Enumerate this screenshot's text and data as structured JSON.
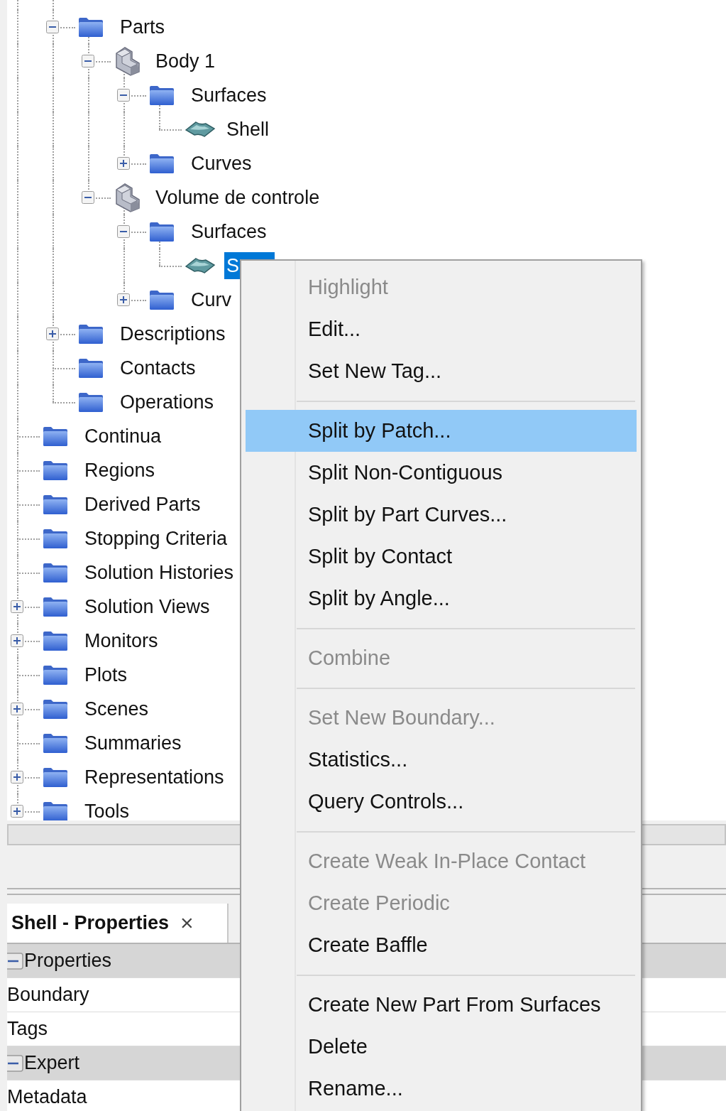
{
  "tree": {
    "items": [
      {
        "children": [
          {
            "label": "Parts",
            "kind": "folder",
            "expanded": true,
            "selected": false,
            "children": [
              {
                "label": "Body 1",
                "kind": "body",
                "expanded": true,
                "selected": false,
                "children": [
                  {
                    "label": "Surfaces",
                    "kind": "folder",
                    "expanded": true,
                    "selected": false,
                    "children": [
                      {
                        "label": "Shell",
                        "kind": "surface",
                        "selected": false
                      }
                    ]
                  },
                  {
                    "label": "Curves",
                    "kind": "folder",
                    "expanded": false,
                    "selected": false
                  }
                ]
              },
              {
                "label": "Volume de controle",
                "kind": "body",
                "expanded": true,
                "selected": false,
                "children": [
                  {
                    "label": "Surfaces",
                    "kind": "folder",
                    "expanded": true,
                    "selected": false,
                    "children": [
                      {
                        "label": "S",
                        "kind": "surface",
                        "selected": true
                      }
                    ]
                  },
                  {
                    "label": "Curv",
                    "kind": "folder",
                    "expanded": false,
                    "selected": false
                  }
                ]
              }
            ]
          },
          {
            "label": "Descriptions",
            "kind": "folder",
            "expanded": false,
            "selected": false
          },
          {
            "label": "Contacts",
            "kind": "folder",
            "selected": false
          },
          {
            "label": "Operations",
            "kind": "folder",
            "selected": false
          }
        ]
      },
      {
        "label": "Continua",
        "kind": "folder",
        "selected": false
      },
      {
        "label": "Regions",
        "kind": "folder",
        "selected": false
      },
      {
        "label": "Derived Parts",
        "kind": "folder",
        "selected": false
      },
      {
        "label": "Stopping Criteria",
        "kind": "folder",
        "selected": false
      },
      {
        "label": "Solution Histories",
        "kind": "folder",
        "selected": false
      },
      {
        "label": "Solution Views",
        "kind": "folder",
        "expanded": false,
        "selected": false
      },
      {
        "label": "Monitors",
        "kind": "folder",
        "expanded": false,
        "selected": false
      },
      {
        "label": "Plots",
        "kind": "folder",
        "selected": false
      },
      {
        "label": "Scenes",
        "kind": "folder",
        "expanded": false,
        "selected": false
      },
      {
        "label": "Summaries",
        "kind": "folder",
        "selected": false
      },
      {
        "label": "Representations",
        "kind": "folder",
        "expanded": false,
        "selected": false
      },
      {
        "label": "Tools",
        "kind": "folder",
        "expanded": false,
        "selected": false
      }
    ]
  },
  "properties_panel": {
    "tab": {
      "title": "Shell - Properties",
      "close": "×"
    },
    "rows": [
      {
        "kind": "group",
        "label": "Properties",
        "expanded": true
      },
      {
        "kind": "property",
        "label": "Boundary"
      },
      {
        "kind": "property",
        "label": "Tags"
      },
      {
        "kind": "group",
        "label": "Expert",
        "expanded": true
      },
      {
        "kind": "property",
        "label": "Metadata"
      }
    ]
  },
  "context_menu": {
    "groups": [
      [
        {
          "label": "Highlight",
          "disabled": true,
          "selected": false
        },
        {
          "label": "Edit...",
          "disabled": false,
          "selected": false
        },
        {
          "label": "Set New Tag...",
          "disabled": false,
          "selected": false
        }
      ],
      [
        {
          "label": "Split by Patch...",
          "disabled": false,
          "selected": true
        },
        {
          "label": "Split Non-Contiguous",
          "disabled": false,
          "selected": false
        },
        {
          "label": "Split by Part Curves...",
          "disabled": false,
          "selected": false
        },
        {
          "label": "Split by Contact",
          "disabled": false,
          "selected": false
        },
        {
          "label": "Split by Angle...",
          "disabled": false,
          "selected": false
        }
      ],
      [
        {
          "label": "Combine",
          "disabled": true,
          "selected": false
        }
      ],
      [
        {
          "label": "Set New Boundary...",
          "disabled": true,
          "selected": false
        },
        {
          "label": "Statistics...",
          "disabled": false,
          "selected": false
        },
        {
          "label": "Query Controls...",
          "disabled": false,
          "selected": false
        }
      ],
      [
        {
          "label": "Create Weak In-Place Contact",
          "disabled": true,
          "selected": false
        },
        {
          "label": "Create Periodic",
          "disabled": true,
          "selected": false
        },
        {
          "label": "Create Baffle",
          "disabled": false,
          "selected": false
        }
      ],
      [
        {
          "label": "Create New Part From Surfaces",
          "disabled": false,
          "selected": false
        },
        {
          "label": "Delete",
          "disabled": false,
          "selected": false
        },
        {
          "label": "Rename...",
          "disabled": false,
          "selected": false
        }
      ]
    ]
  }
}
